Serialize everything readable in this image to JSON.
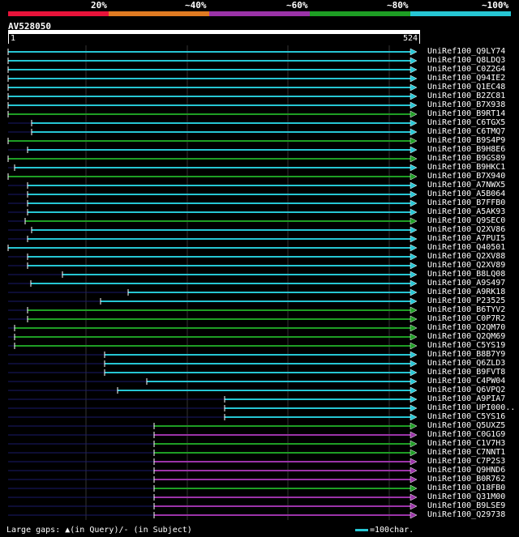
{
  "query": {
    "id": "AV528050",
    "start": "1",
    "end": "524"
  },
  "scale": {
    "labels": [
      "20%",
      "~40%",
      "~60%",
      "~80%",
      "~100%"
    ],
    "colors": [
      "#e8133a",
      "#e07b22",
      "#9b33a8",
      "#1e9e24",
      "#26c6d4"
    ]
  },
  "hits": [
    {
      "label": "UniRef100_Q9LY74",
      "color": "#26c6d4"
    },
    {
      "label": "UniRef100_Q8LDQ3",
      "color": "#26c6d4"
    },
    {
      "label": "UniRef100_C0Z2G4",
      "color": "#26c6d4"
    },
    {
      "label": "UniRef100_Q94IE2",
      "color": "#26c6d4"
    },
    {
      "label": "UniRef100_Q1EC48",
      "color": "#26c6d4"
    },
    {
      "label": "UniRef100_B2ZC81",
      "color": "#26c6d4"
    },
    {
      "label": "UniRef100_B7X938",
      "color": "#26c6d4"
    },
    {
      "label": "UniRef100_B9RT14",
      "color": "#1e9e24"
    },
    {
      "label": "UniRef100_C6TGX5",
      "color": "#26c6d4"
    },
    {
      "label": "UniRef100_C6TMQ7",
      "color": "#26c6d4"
    },
    {
      "label": "UniRef100_B9S4P9",
      "color": "#1e9e24"
    },
    {
      "label": "UniRef100_B9H8E6",
      "color": "#26c6d4"
    },
    {
      "label": "UniRef100_B9GS89",
      "color": "#1e9e24"
    },
    {
      "label": "UniRef100_B9HKC1",
      "color": "#26c6d4"
    },
    {
      "label": "UniRef100_B7X940",
      "color": "#1e9e24"
    },
    {
      "label": "UniRef100_A7NWX5",
      "color": "#26c6d4"
    },
    {
      "label": "UniRef100_A5B064",
      "color": "#26c6d4"
    },
    {
      "label": "UniRef100_B7FFB0",
      "color": "#26c6d4"
    },
    {
      "label": "UniRef100_A5AK93",
      "color": "#26c6d4"
    },
    {
      "label": "UniRef100_Q9SEC0",
      "color": "#1e9e24"
    },
    {
      "label": "UniRef100_Q2XV86",
      "color": "#26c6d4"
    },
    {
      "label": "UniRef100_A7PUI5",
      "color": "#26c6d4"
    },
    {
      "label": "UniRef100_Q40501",
      "color": "#26c6d4"
    },
    {
      "label": "UniRef100_Q2XV88",
      "color": "#26c6d4"
    },
    {
      "label": "UniRef100_Q2XV89",
      "color": "#26c6d4"
    },
    {
      "label": "UniRef100_B8LQ08",
      "color": "#26c6d4"
    },
    {
      "label": "UniRef100_A9S497",
      "color": "#26c6d4"
    },
    {
      "label": "UniRef100_A9RK18",
      "color": "#26c6d4"
    },
    {
      "label": "UniRef100_P23525",
      "color": "#26c6d4"
    },
    {
      "label": "UniRef100_B6TYV2",
      "color": "#1e9e24"
    },
    {
      "label": "UniRef100_C0P7R2",
      "color": "#1e9e24"
    },
    {
      "label": "UniRef100_Q2QM70",
      "color": "#1e9e24"
    },
    {
      "label": "UniRef100_Q2QM69",
      "color": "#1e9e24"
    },
    {
      "label": "UniRef100_C5YS19",
      "color": "#1e9e24"
    },
    {
      "label": "UniRef100_B8B7Y9",
      "color": "#26c6d4"
    },
    {
      "label": "UniRef100_Q6ZLD3",
      "color": "#26c6d4"
    },
    {
      "label": "UniRef100_B9FVT8",
      "color": "#26c6d4"
    },
    {
      "label": "UniRef100_C4PW04",
      "color": "#26c6d4"
    },
    {
      "label": "UniRef100_Q6VPQ2",
      "color": "#26c6d4"
    },
    {
      "label": "UniRef100_A9PIA7",
      "color": "#26c6d4"
    },
    {
      "label": "UniRef100_UPI000..",
      "color": "#26c6d4"
    },
    {
      "label": "UniRef100_C5YS16",
      "color": "#26c6d4"
    },
    {
      "label": "UniRef100_Q5UXZ5",
      "color": "#1e9e24"
    },
    {
      "label": "UniRef100_C0G1G9",
      "color": "#9b33a8"
    },
    {
      "label": "UniRef100_C1V7H3",
      "color": "#1e9e24"
    },
    {
      "label": "UniRef100_C7NNT1",
      "color": "#1e9e24"
    },
    {
      "label": "UniRef100_C7P2S3",
      "color": "#9b33a8"
    },
    {
      "label": "UniRef100_Q9HND6",
      "color": "#9b33a8"
    },
    {
      "label": "UniRef100_B0R762",
      "color": "#9b33a8"
    },
    {
      "label": "UniRef100_Q18FB0",
      "color": "#1e9e24"
    },
    {
      "label": "UniRef100_Q31M00",
      "color": "#9b33a8"
    },
    {
      "label": "UniRef100_B9LSE9",
      "color": "#9b33a8"
    },
    {
      "label": "UniRef100_Q29738",
      "color": "#9b33a8"
    }
  ],
  "footer": {
    "gaps_text": "Large gaps: ▲(in Query)/- (in Subject)",
    "scale_text": "=100char."
  }
}
